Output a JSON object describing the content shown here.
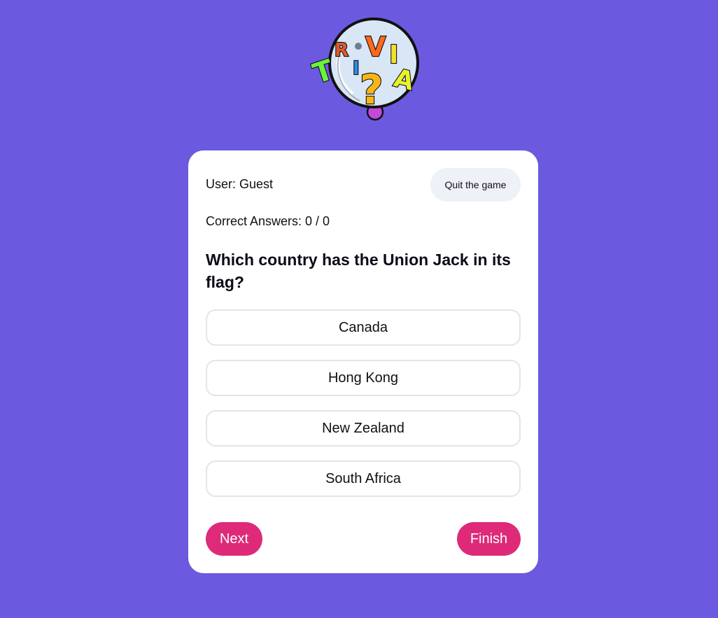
{
  "logo": {
    "letters": [
      "T",
      "R",
      "I",
      "V",
      "I",
      "A"
    ],
    "mark": "?"
  },
  "user": {
    "label": "User: Guest"
  },
  "actions": {
    "quit_label": "Quit the game",
    "next_label": "Next",
    "finish_label": "Finish"
  },
  "score": {
    "label": "Correct Answers: 0 / 0"
  },
  "question": {
    "text": "Which country has the Union Jack in its flag?",
    "answers": [
      "Canada",
      "Hong Kong",
      "New Zealand",
      "South Africa"
    ]
  },
  "colors": {
    "background": "#6b5ae0",
    "card": "#ffffff",
    "accent": "#de2a78",
    "quit_button": "#eef1f7"
  }
}
